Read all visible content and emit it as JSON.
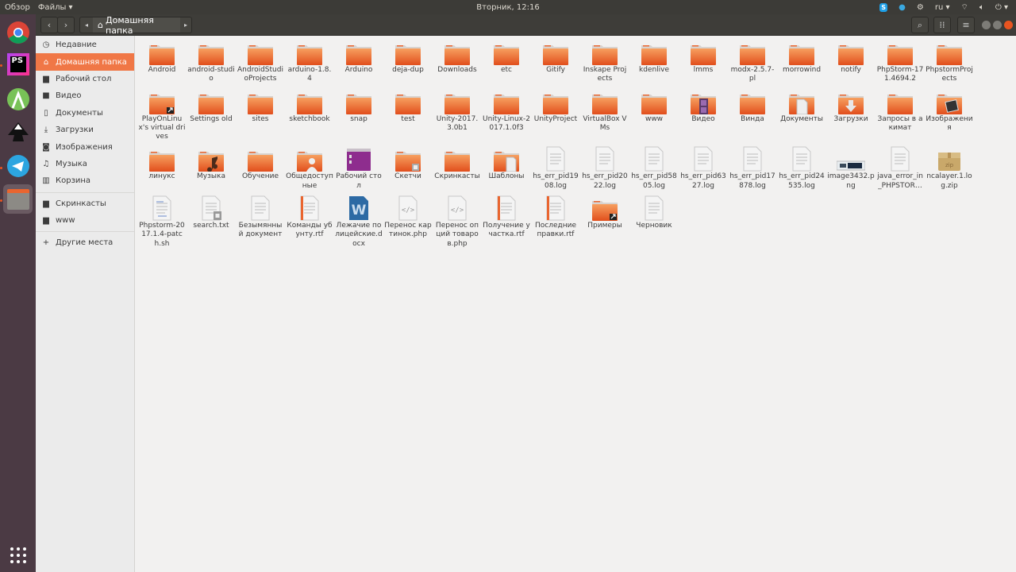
{
  "topbar": {
    "overview": "Обзор",
    "app_menu": "Файлы ▾",
    "clock": "Вторник, 12:16",
    "lang": "ru ▾"
  },
  "header": {
    "location": "Домашняя папка"
  },
  "sidebar": {
    "items": [
      {
        "label": "Недавние",
        "icon": "clock"
      },
      {
        "label": "Домашняя папка",
        "icon": "home",
        "active": true
      },
      {
        "label": "Рабочий стол",
        "icon": "folder"
      },
      {
        "label": "Видео",
        "icon": "video"
      },
      {
        "label": "Документы",
        "icon": "document"
      },
      {
        "label": "Загрузки",
        "icon": "download"
      },
      {
        "label": "Изображения",
        "icon": "camera"
      },
      {
        "label": "Музыка",
        "icon": "music"
      },
      {
        "label": "Корзина",
        "icon": "trash"
      }
    ],
    "bookmarks": [
      {
        "label": "Скринкасты",
        "icon": "folder"
      },
      {
        "label": "www",
        "icon": "folder"
      }
    ],
    "other": {
      "label": "Другие места",
      "icon": "plus"
    }
  },
  "files": [
    [
      {
        "name": "Android",
        "type": "folder"
      },
      {
        "name": "android-studio",
        "type": "folder"
      },
      {
        "name": "AndroidStudioProjects",
        "type": "folder"
      },
      {
        "name": "arduino-1.8.4",
        "type": "folder"
      },
      {
        "name": "Arduino",
        "type": "folder"
      },
      {
        "name": "deja-dup",
        "type": "folder"
      },
      {
        "name": "Downloads",
        "type": "folder"
      },
      {
        "name": "etc",
        "type": "folder"
      },
      {
        "name": "Gitify",
        "type": "folder"
      },
      {
        "name": "Inskape Projects",
        "type": "folder"
      },
      {
        "name": "kdenlive",
        "type": "folder"
      },
      {
        "name": "lmms",
        "type": "folder"
      },
      {
        "name": "modx-2.5.7-pl",
        "type": "folder"
      },
      {
        "name": "morrowind",
        "type": "folder"
      },
      {
        "name": "notify",
        "type": "folder"
      },
      {
        "name": "PhpStorm-171.4694.2",
        "type": "folder"
      },
      {
        "name": "PhpstormProjects",
        "type": "folder"
      }
    ],
    [
      {
        "name": "PlayOnLinux's virtual drives",
        "type": "folder-link"
      },
      {
        "name": "Settings old",
        "type": "folder"
      },
      {
        "name": "sites",
        "type": "folder"
      },
      {
        "name": "sketchbook",
        "type": "folder"
      },
      {
        "name": "snap",
        "type": "folder"
      },
      {
        "name": "test",
        "type": "folder"
      },
      {
        "name": "Unity-2017.3.0b1",
        "type": "folder"
      },
      {
        "name": "Unity-Linux-2017.1.0f3",
        "type": "folder"
      },
      {
        "name": "UnityProject",
        "type": "folder"
      },
      {
        "name": "VirtualBox VMs",
        "type": "folder"
      },
      {
        "name": "www",
        "type": "folder"
      },
      {
        "name": "Видео",
        "type": "folder-video"
      },
      {
        "name": "Винда",
        "type": "folder"
      },
      {
        "name": "Документы",
        "type": "folder-docs"
      },
      {
        "name": "Загрузки",
        "type": "folder-download"
      },
      {
        "name": "Запросы в акимат",
        "type": "folder"
      },
      {
        "name": "Изображения",
        "type": "folder-images"
      }
    ],
    [
      {
        "name": "линукс",
        "type": "folder"
      },
      {
        "name": "Музыка",
        "type": "folder-music"
      },
      {
        "name": "Обучение",
        "type": "folder"
      },
      {
        "name": "Общедоступные",
        "type": "folder-public"
      },
      {
        "name": "Рабочий стол",
        "type": "desktop"
      },
      {
        "name": "Скетчи",
        "type": "folder-lock"
      },
      {
        "name": "Скринкасты",
        "type": "folder"
      },
      {
        "name": "Шаблоны",
        "type": "folder-templates"
      },
      {
        "name": "hs_err_pid1908.log",
        "type": "text"
      },
      {
        "name": "hs_err_pid2022.log",
        "type": "text"
      },
      {
        "name": "hs_err_pid5805.log",
        "type": "text"
      },
      {
        "name": "hs_err_pid6327.log",
        "type": "text"
      },
      {
        "name": "hs_err_pid17878.log",
        "type": "text"
      },
      {
        "name": "hs_err_pid24535.log",
        "type": "text"
      },
      {
        "name": "image3432.png",
        "type": "image"
      },
      {
        "name": "java_error_in_PHPSTOR…",
        "type": "text"
      },
      {
        "name": "ncalayer.1.log.zip",
        "type": "zip"
      }
    ],
    [
      {
        "name": "Phpstorm-2017.1.4-patch.sh",
        "type": "script"
      },
      {
        "name": "search.txt",
        "type": "text-lock"
      },
      {
        "name": "Безымянный документ",
        "type": "text"
      },
      {
        "name": "Команды убунту.rtf",
        "type": "rtf"
      },
      {
        "name": "Лежачие полицейские.docx",
        "type": "word"
      },
      {
        "name": "Перенос картинок.php",
        "type": "php"
      },
      {
        "name": "Перенос опций товаров.php",
        "type": "php"
      },
      {
        "name": "Получение участка.rtf",
        "type": "rtf"
      },
      {
        "name": "Последние правки.rtf",
        "type": "rtf"
      },
      {
        "name": "Примеры",
        "type": "folder-link"
      },
      {
        "name": "Черновик",
        "type": "text"
      }
    ]
  ],
  "colors": {
    "accent": "#f07746",
    "folder": "#e9652f",
    "launcher": "#4b3a44"
  }
}
